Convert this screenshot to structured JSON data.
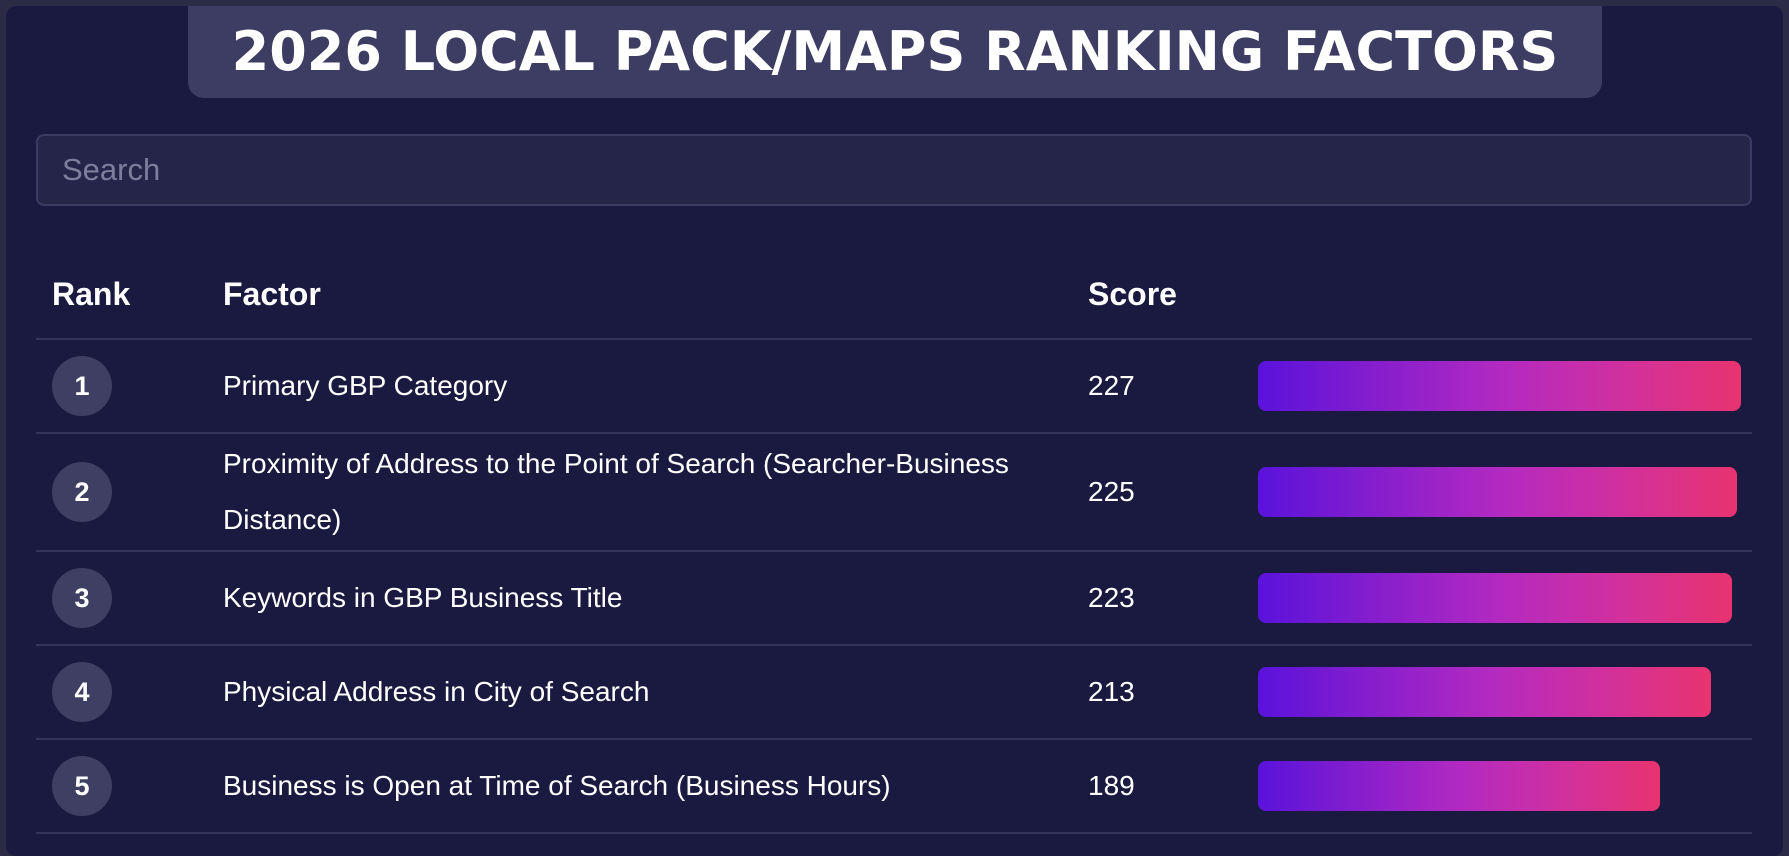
{
  "header": {
    "title": "2026 LOCAL PACK/MAPS RANKING FACTORS"
  },
  "search": {
    "placeholder": "Search",
    "value": ""
  },
  "table": {
    "columns": {
      "rank": "Rank",
      "factor": "Factor",
      "score": "Score"
    },
    "max_score": 227,
    "rows": [
      {
        "rank": "1",
        "factor": "Primary GBP Category",
        "score": "227",
        "score_value": 227
      },
      {
        "rank": "2",
        "factor": "Proximity of Address to the Point of Search (Searcher-Business Distance)",
        "score": "225",
        "score_value": 225
      },
      {
        "rank": "3",
        "factor": "Keywords in GBP Business Title",
        "score": "223",
        "score_value": 223
      },
      {
        "rank": "4",
        "factor": "Physical Address in City of Search",
        "score": "213",
        "score_value": 213
      },
      {
        "rank": "5",
        "factor": "Business is Open at Time of Search (Business Hours)",
        "score": "189",
        "score_value": 189
      }
    ]
  },
  "colors": {
    "background": "#1a1a40",
    "title_tab": "#3d3d63",
    "badge": "#3f3f63",
    "bar_start": "#5a12dc",
    "bar_end": "#e8336f"
  }
}
